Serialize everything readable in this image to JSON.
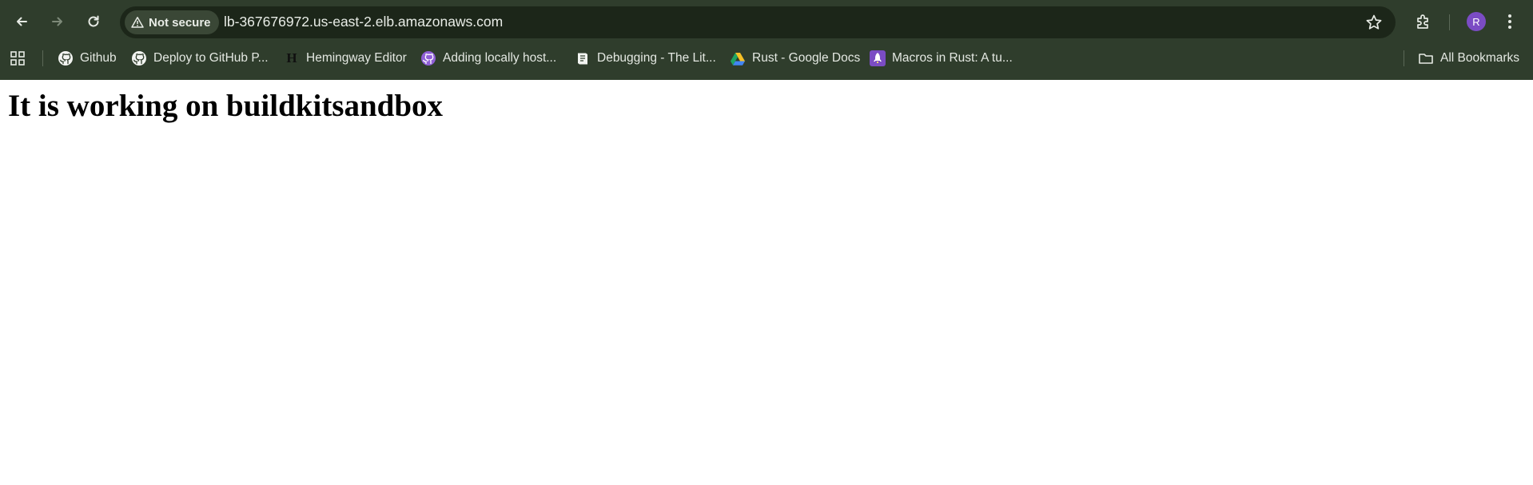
{
  "browser": {
    "security_label": "Not secure",
    "url": "lb-367676972.us-east-2.elb.amazonaws.com",
    "profile_initial": "R",
    "colors": {
      "frame": "#2f3d2c",
      "omnibox": "#1c2619",
      "avatar": "#7b4cc4"
    }
  },
  "bookmarks": {
    "items": [
      {
        "label": "Github",
        "icon": "github-icon"
      },
      {
        "label": "Deploy to GitHub P...",
        "icon": "github-icon"
      },
      {
        "label": "Hemingway Editor",
        "icon": "hemingway-icon"
      },
      {
        "label": "Adding locally host...",
        "icon": "github-purple-icon"
      },
      {
        "label": "Debugging - The Lit...",
        "icon": "book-icon"
      },
      {
        "label": "Rust - Google Docs",
        "icon": "google-drive-icon"
      },
      {
        "label": "Macros in Rust: A tu...",
        "icon": "rocket-icon"
      }
    ],
    "all_bookmarks_label": "All Bookmarks"
  },
  "page": {
    "heading": "It is working on buildkitsandbox"
  }
}
